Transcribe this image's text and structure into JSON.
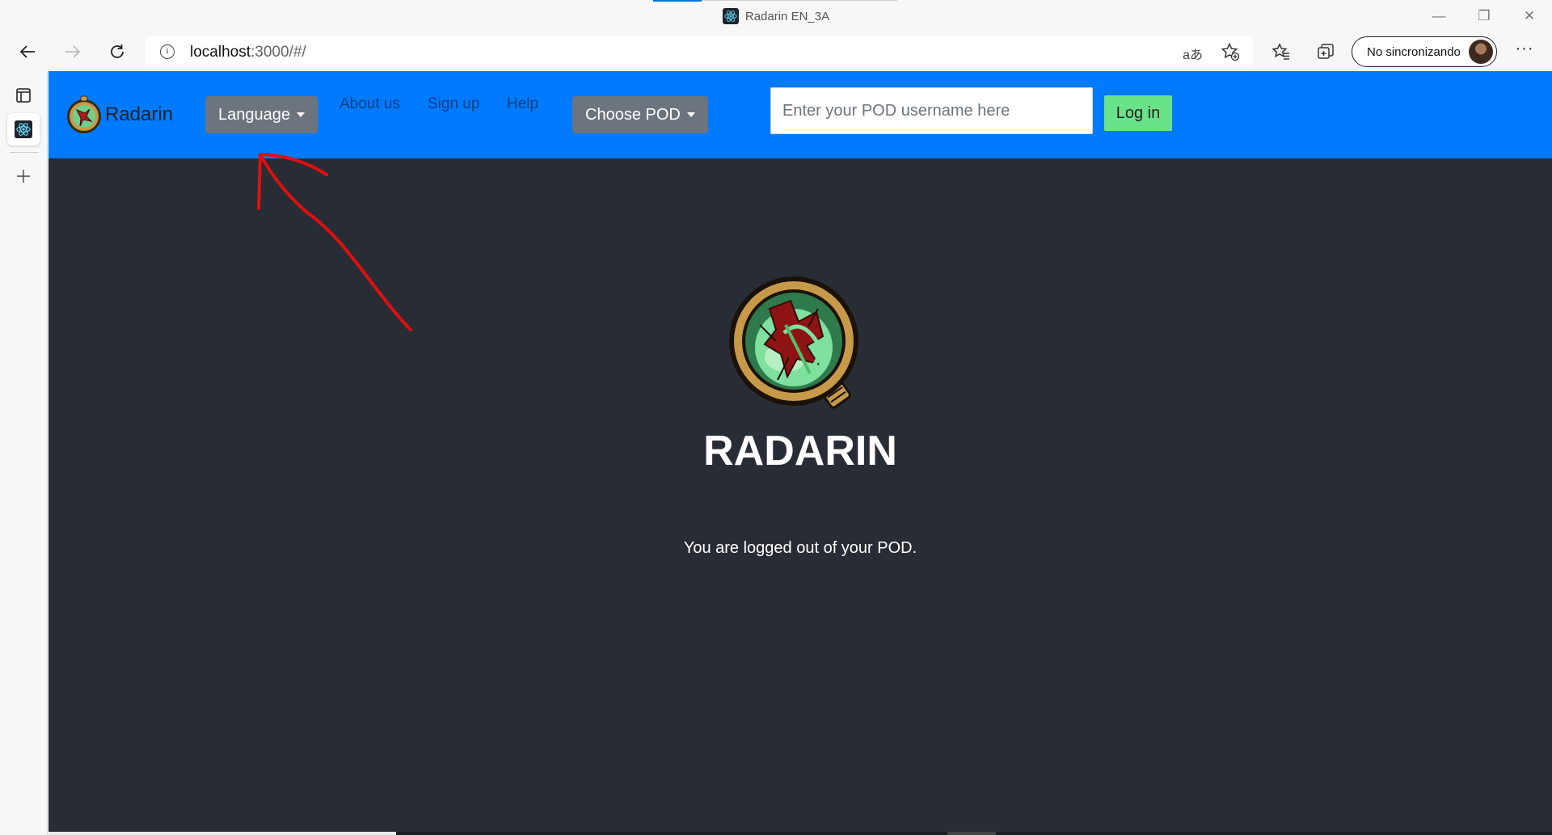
{
  "window": {
    "title": "Radarin EN_3A",
    "controls": [
      "—",
      "❐",
      "✕"
    ]
  },
  "browser": {
    "url_host": "localhost",
    "url_path": ":3000/#/",
    "profile_label": "No sincronizando",
    "more_label": "···"
  },
  "navbar": {
    "brand": "Radarin",
    "language_label": "Language",
    "links": [
      "About us",
      "Sign up",
      "Help"
    ],
    "choose_pod_label": "Choose POD",
    "pod_input_placeholder": "Enter your POD username here",
    "login_label": "Log in"
  },
  "main": {
    "title": "RADARIN",
    "status": "You are logged out of your POD."
  },
  "colors": {
    "navbar": "#007bff",
    "page_background": "#282c34",
    "dropdown_button": "#6c757d",
    "login_button": "#6ae28a",
    "annotation_arrow": "#e01010"
  },
  "icons": [
    "back-arrow-icon",
    "forward-arrow-icon",
    "refresh-icon",
    "info-icon",
    "read-aloud-icon",
    "add-favorite-icon",
    "favorites-icon",
    "collections-icon",
    "tab-actions-icon",
    "react-tab-icon",
    "new-tab-icon"
  ]
}
